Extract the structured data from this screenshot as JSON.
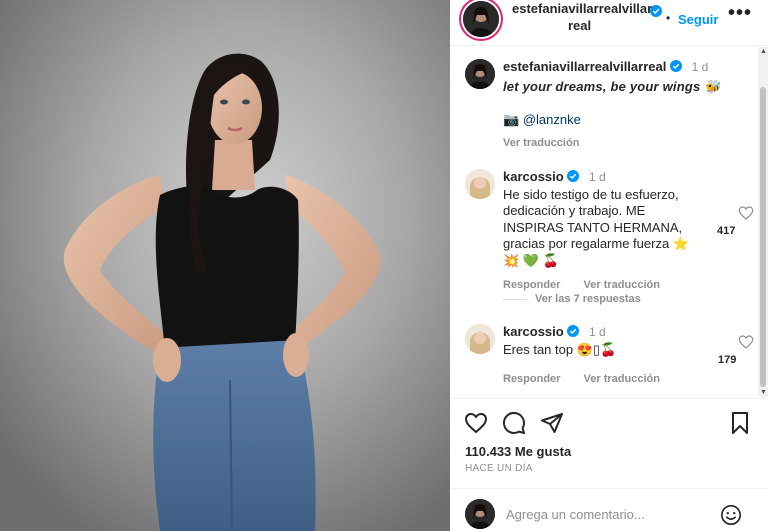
{
  "post": {
    "author": "estefaniavillarrealvillarreal",
    "author_line1": "estefaniavillarrealvillar",
    "author_line2": "real",
    "follow_label": "Seguir",
    "more_label": "•••",
    "dot": "•"
  },
  "caption": {
    "username": "estefaniavillarrealvillarreal",
    "time": "1 d",
    "text": "let your dreams, be your wings 🐝",
    "mention_prefix": "📷",
    "mention": "@lanznke",
    "translate_label": "Ver traducción"
  },
  "comments": [
    {
      "username": "karcossio",
      "time": "1 d",
      "text": "He sido testigo de tu esfuerzo, dedicación y trabajo. ME INSPIRAS TANTO HERMANA, gracias por regalarme fuerza ⭐ 💥 💚 🍒",
      "likes": "417",
      "reply_label": "Responder",
      "translate_label": "Ver traducción",
      "replies_label": "Ver las 7 respuestas"
    },
    {
      "username": "karcossio",
      "time": "1 d",
      "text": "Eres tan top 😍▯🍒",
      "likes": "179",
      "reply_label": "Responder",
      "translate_label": "Ver traducción"
    }
  ],
  "actions": {
    "likes": "110.433 Me gusta",
    "ago": "HACE UN DÍA",
    "icons": [
      "heart-icon",
      "comment-icon",
      "share-icon",
      "bookmark-icon"
    ]
  },
  "add_comment": {
    "placeholder": "Agrega un comentario..."
  },
  "colors": {
    "accent": "#0095f6",
    "verified": "#0095f6",
    "muted": "#8e8e8e",
    "text": "#262626"
  }
}
